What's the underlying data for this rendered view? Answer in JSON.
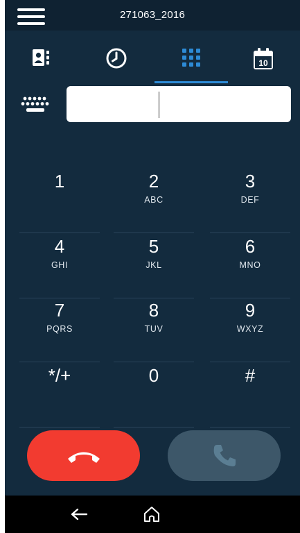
{
  "header": {
    "title": "271063_2016"
  },
  "tabs": [
    {
      "name": "contacts",
      "icon": "contacts-icon"
    },
    {
      "name": "history",
      "icon": "clock-icon"
    },
    {
      "name": "dialpad",
      "icon": "dialpad-icon",
      "active": true
    },
    {
      "name": "calendar",
      "icon": "calendar-icon",
      "badge": "10"
    }
  ],
  "input": {
    "value": "",
    "placeholder": ""
  },
  "keypad": [
    {
      "digit": "1",
      "letters": ""
    },
    {
      "digit": "2",
      "letters": "ABC"
    },
    {
      "digit": "3",
      "letters": "DEF"
    },
    {
      "digit": "4",
      "letters": "GHI"
    },
    {
      "digit": "5",
      "letters": "JKL"
    },
    {
      "digit": "6",
      "letters": "MNO"
    },
    {
      "digit": "7",
      "letters": "PQRS"
    },
    {
      "digit": "8",
      "letters": "TUV"
    },
    {
      "digit": "9",
      "letters": "WXYZ"
    },
    {
      "digit": "*/+",
      "letters": ""
    },
    {
      "digit": "0",
      "letters": ""
    },
    {
      "digit": "#",
      "letters": ""
    }
  ],
  "colors": {
    "background": "#132b3e",
    "accent": "#2d8bd6",
    "end_call": "#f23b30",
    "call_disabled": "#3d5769"
  }
}
